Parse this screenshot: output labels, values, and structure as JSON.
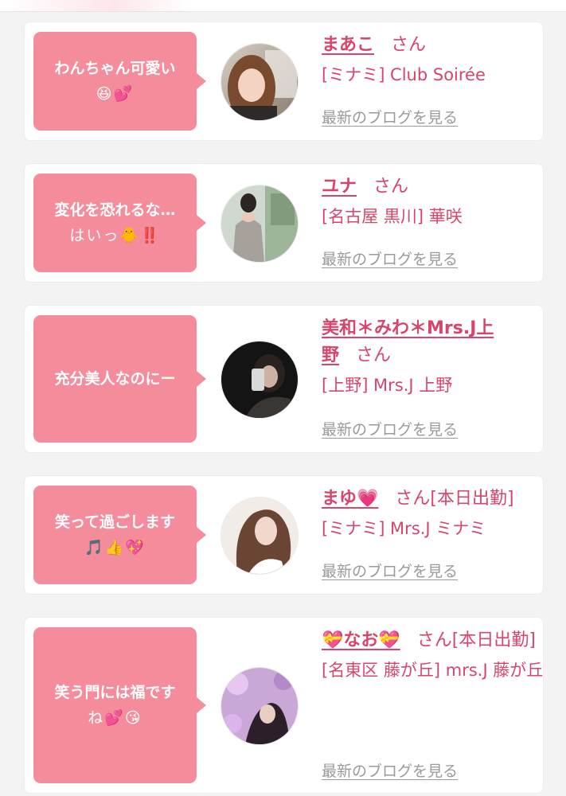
{
  "colors": {
    "accent_pink": "#d9456a",
    "bubble_pink": "#f48c9c",
    "link_gray": "#9a9a9a",
    "background": "#f3f3f3"
  },
  "cards": [
    {
      "comment_lines": [
        "わんちゃん可愛い",
        "😆💕"
      ],
      "name": "まあこ",
      "suffix": "さん",
      "shop": "[ミナミ] Club Soirée",
      "blog_link": "最新のブログを見る",
      "avatar_icon": "avatar-photo"
    },
    {
      "comment_lines": [
        "変化を恐れるな…",
        "はいっ🐥‼️"
      ],
      "name": "ユナ",
      "suffix": "さん",
      "shop": "[名古屋 黒川] 華咲",
      "blog_link": "最新のブログを見る",
      "avatar_icon": "avatar-photo"
    },
    {
      "comment_lines": [
        "充分美人なのにー"
      ],
      "name": "美和＊みわ＊Mrs.J上野",
      "suffix": "さん",
      "shop": "[上野] Mrs.J 上野",
      "blog_link": "最新のブログを見る",
      "avatar_icon": "avatar-photo"
    },
    {
      "comment_lines": [
        "笑って過ごします",
        "🎵👍💖"
      ],
      "name": "まゆ💗",
      "suffix": "さん[本日出勤]",
      "shop": "[ミナミ] Mrs.J ミナミ",
      "blog_link": "最新のブログを見る",
      "avatar_icon": "avatar-photo"
    },
    {
      "comment_lines": [
        "笑う門には福です",
        "ね💕😘"
      ],
      "name": "💝なお💝",
      "suffix": "さん[本日出勤]",
      "shop": "[名東区 藤が丘] mrs.J 藤が丘",
      "blog_link": "最新のブログを見る",
      "avatar_icon": "avatar-photo"
    }
  ]
}
